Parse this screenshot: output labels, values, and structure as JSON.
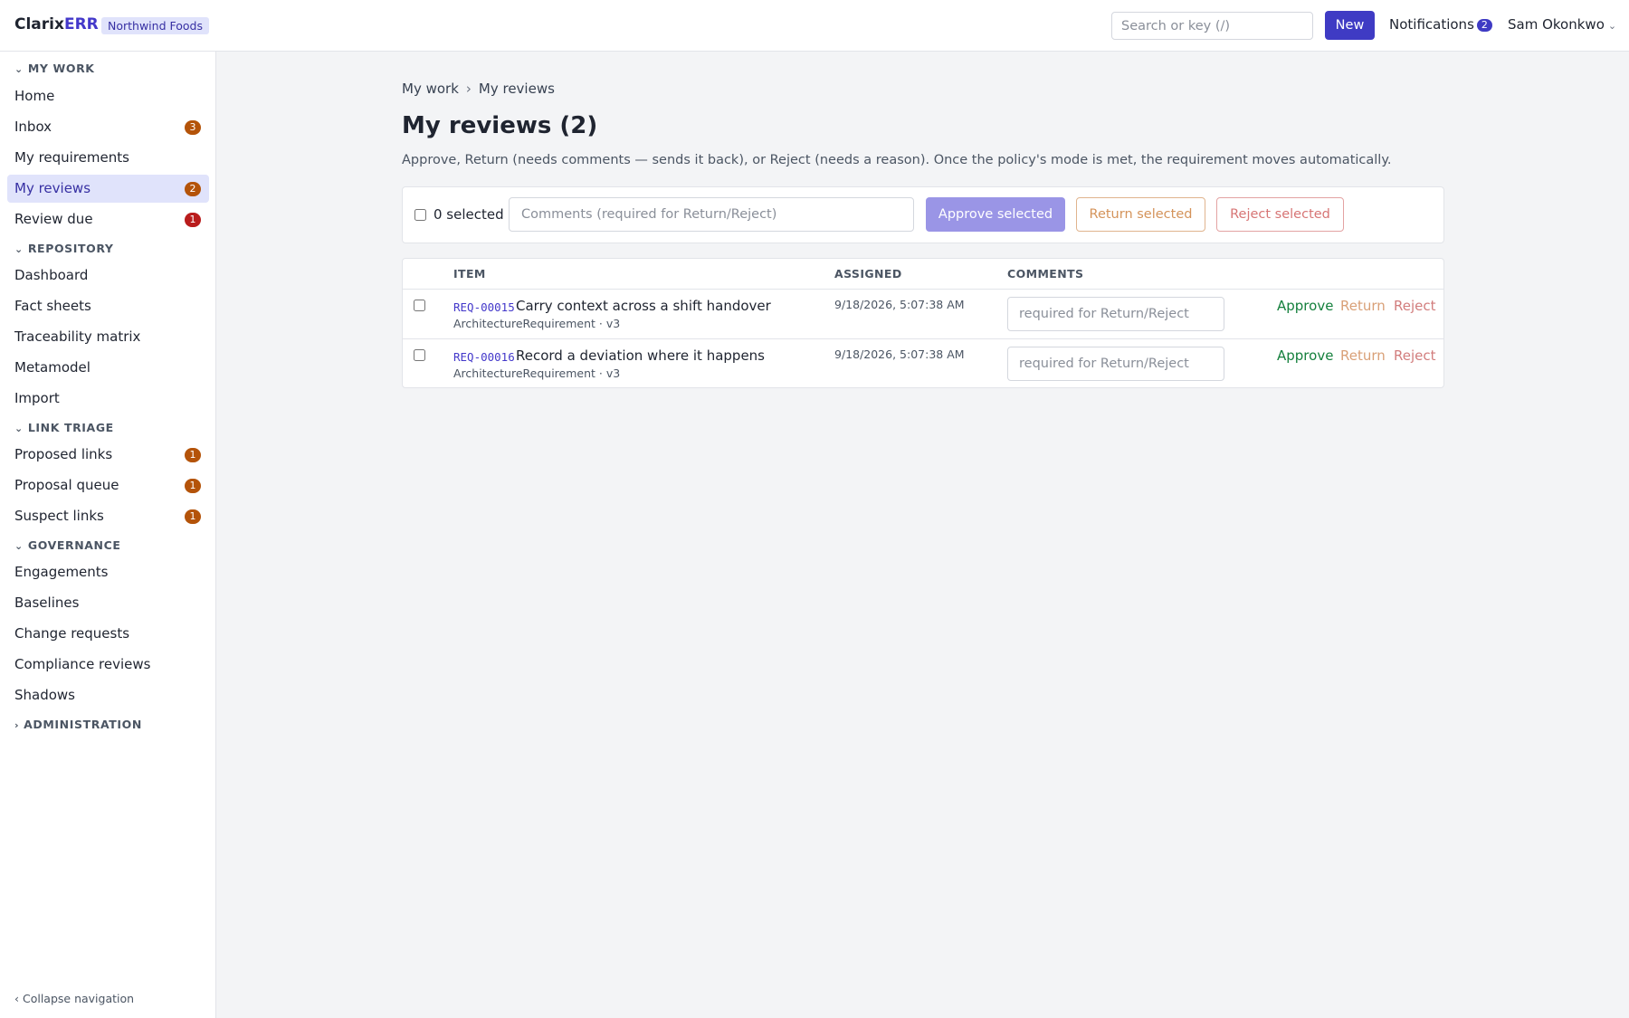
{
  "app": {
    "brand_prefix": "Clarix",
    "brand_suffix": "ERR",
    "org": "Northwind Foods"
  },
  "header": {
    "search_placeholder": "Search or key (/)",
    "new_label": "New",
    "notifications_label": "Notifications",
    "notifications_count": "2",
    "user_name": "Sam Okonkwo",
    "user_chevron": "⌄"
  },
  "sidebar": {
    "sections": [
      {
        "label": "MY WORK",
        "caret": "⌄"
      },
      {
        "label": "REPOSITORY",
        "caret": "⌄"
      },
      {
        "label": "LINK TRIAGE",
        "caret": "⌄"
      },
      {
        "label": "GOVERNANCE",
        "caret": "⌄"
      },
      {
        "label": "ADMINISTRATION",
        "caret": "›"
      }
    ],
    "items": [
      {
        "label": "Home"
      },
      {
        "label": "Inbox",
        "badge": "3"
      },
      {
        "label": "My requirements"
      },
      {
        "label": "My reviews",
        "badge": "2"
      },
      {
        "label": "Review due",
        "badge": "1"
      },
      {
        "label": "Dashboard"
      },
      {
        "label": "Fact sheets"
      },
      {
        "label": "Traceability matrix"
      },
      {
        "label": "Metamodel"
      },
      {
        "label": "Import"
      },
      {
        "label": "Proposed links",
        "badge": "1"
      },
      {
        "label": "Proposal queue",
        "badge": "1"
      },
      {
        "label": "Suspect links",
        "badge": "1"
      },
      {
        "label": "Engagements"
      },
      {
        "label": "Baselines"
      },
      {
        "label": "Change requests"
      },
      {
        "label": "Compliance reviews"
      },
      {
        "label": "Shadows"
      }
    ],
    "collapse_label": "‹ Collapse navigation"
  },
  "main": {
    "breadcrumb": [
      "My work",
      "My reviews"
    ],
    "breadcrumb_sep": "›",
    "title": "My reviews (2)",
    "help": "Approve, Return (needs comments — sends it back), or Reject (needs a reason). Once the policy's mode is met, the requirement moves automatically.",
    "bulk": {
      "selected_text": "0 selected",
      "comments_placeholder": "Comments (required for Return/Reject)",
      "approve_label": "Approve selected",
      "return_label": "Return selected",
      "reject_label": "Reject selected"
    },
    "table": {
      "headers": [
        "ITEM",
        "ASSIGNED",
        "COMMENTS"
      ],
      "rows": [
        {
          "id": "REQ-00015",
          "title": "Carry context across a shift handover",
          "meta": "ArchitectureRequirement · v3",
          "assigned": "9/18/2026, 5:07:38 AM",
          "comment_placeholder": "required for Return/Reject",
          "approve": "Approve",
          "return": "Return",
          "reject": "Reject"
        },
        {
          "id": "REQ-00016",
          "title": "Record a deviation where it happens",
          "meta": "ArchitectureRequirement · v3",
          "assigned": "9/18/2026, 5:07:38 AM",
          "comment_placeholder": "required for Return/Reject",
          "approve": "Approve",
          "return": "Return",
          "reject": "Reject"
        }
      ]
    }
  },
  "colors": {
    "accent": "#3f3bc4",
    "badge_orange": "#b45309",
    "badge_red": "#b91c1c",
    "approve": "#15803d",
    "return": "#d9a077",
    "reject": "#d27d7d"
  }
}
